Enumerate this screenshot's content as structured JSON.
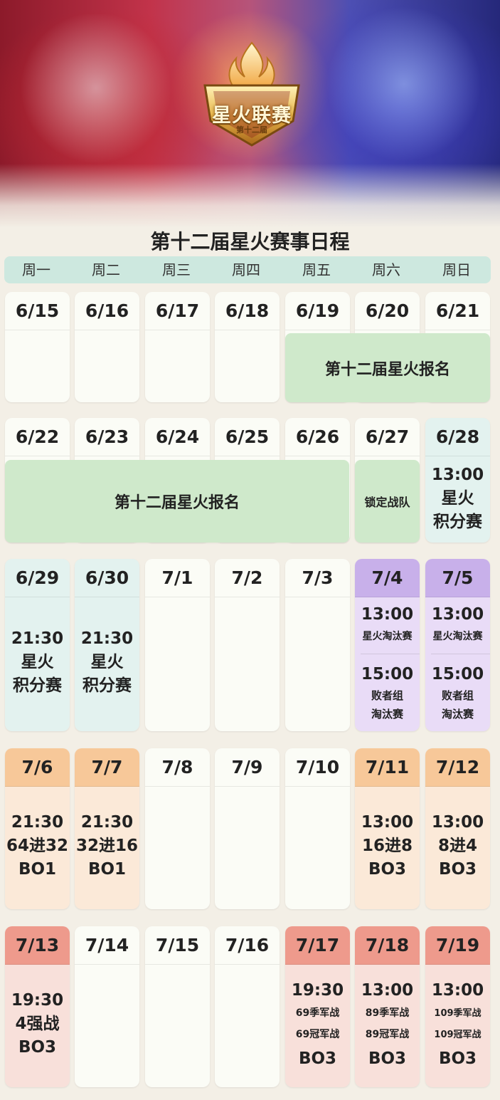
{
  "banner": {
    "logo_title": "星火联赛",
    "logo_subtitle": "第十二届"
  },
  "schedule": {
    "title": "第十二届星火赛事日程",
    "weekdays": [
      "周一",
      "周二",
      "周三",
      "周四",
      "周五",
      "周六",
      "周日"
    ],
    "weeks": [
      {
        "dates": [
          "6/15",
          "6/16",
          "6/17",
          "6/18",
          "6/19",
          "6/20",
          "6/21"
        ],
        "band_label": "第十二届星火报名"
      },
      {
        "dates": [
          "6/22",
          "6/23",
          "6/24",
          "6/25",
          "6/26",
          "6/27",
          "6/28"
        ],
        "band_label": "第十二届星火报名",
        "lock_label": "锁定战队",
        "sun": {
          "time": "13:00",
          "line1": "星火",
          "line2": "积分赛"
        }
      },
      {
        "dates": [
          "6/29",
          "6/30",
          "7/1",
          "7/2",
          "7/3",
          "7/4",
          "7/5"
        ],
        "mon": {
          "time": "21:30",
          "line1": "星火",
          "line2": "积分赛"
        },
        "tue": {
          "time": "21:30",
          "line1": "星火",
          "line2": "积分赛"
        },
        "sat": {
          "time1": "13:00",
          "label1": "星火淘汰赛",
          "time2": "15:00",
          "label2a": "败者组",
          "label2b": "淘汰赛"
        },
        "sun": {
          "time1": "13:00",
          "label1": "星火淘汰赛",
          "time2": "15:00",
          "label2a": "败者组",
          "label2b": "淘汰赛"
        }
      },
      {
        "dates": [
          "7/6",
          "7/7",
          "7/8",
          "7/9",
          "7/10",
          "7/11",
          "7/12"
        ],
        "mon": {
          "time": "21:30",
          "round": "64进32",
          "format": "BO1"
        },
        "tue": {
          "time": "21:30",
          "round": "32进16",
          "format": "BO1"
        },
        "sat": {
          "time": "13:00",
          "round": "16进8",
          "format": "BO3"
        },
        "sun": {
          "time": "13:00",
          "round": "8进4",
          "format": "BO3"
        }
      },
      {
        "dates": [
          "7/13",
          "7/14",
          "7/15",
          "7/16",
          "7/17",
          "7/18",
          "7/19"
        ],
        "mon": {
          "time": "19:30",
          "round": "4强战",
          "format": "BO3"
        },
        "fri": {
          "time": "19:30",
          "line1": "69季军战",
          "line2": "69冠军战",
          "format": "BO3"
        },
        "sat": {
          "time": "13:00",
          "line1": "89季军战",
          "line2": "89冠军战",
          "format": "BO3"
        },
        "sun": {
          "time": "13:00",
          "line1": "109季军战",
          "line2": "109冠军战",
          "format": "BO3"
        }
      }
    ]
  }
}
